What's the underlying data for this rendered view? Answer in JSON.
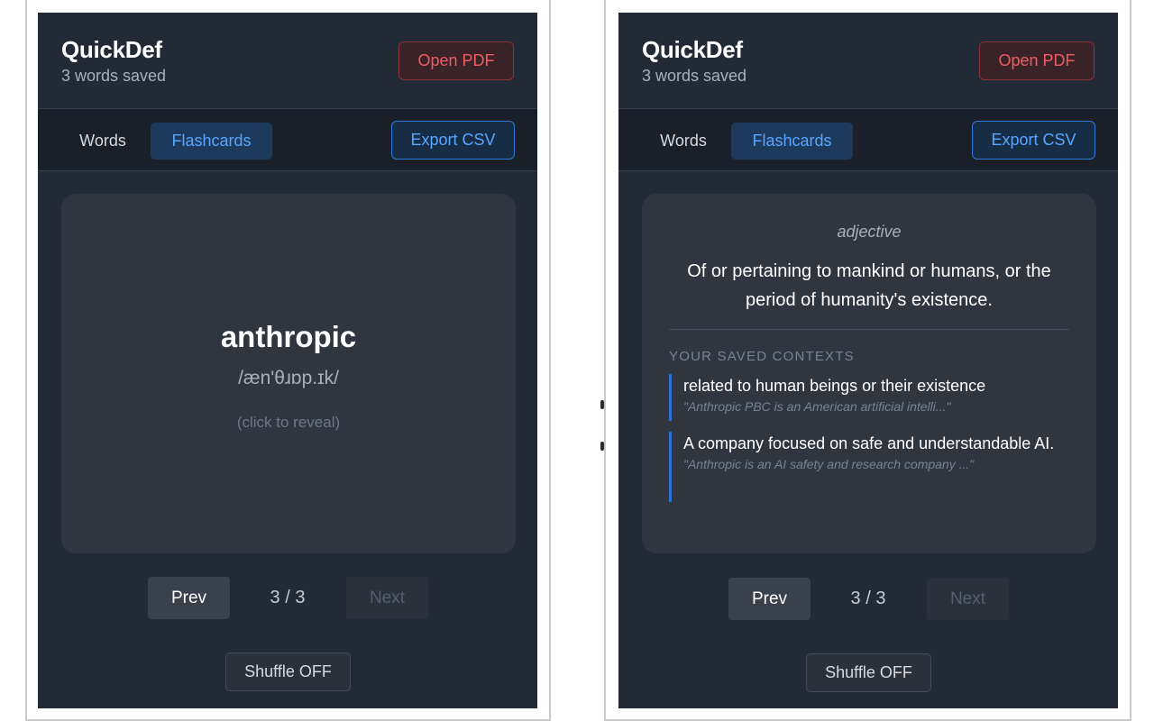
{
  "app": {
    "title": "QuickDef",
    "subtitle": "3 words saved",
    "open_pdf_label": "Open PDF"
  },
  "tabs": {
    "words_label": "Words",
    "flashcards_label": "Flashcards",
    "active": "Flashcards",
    "export_label": "Export CSV"
  },
  "card_front": {
    "word": "anthropic",
    "phonetic": "/æn'θɹɒp.ɪk/",
    "hint": "(click to reveal)"
  },
  "card_back": {
    "part_of_speech": "adjective",
    "definition": "Of or pertaining to mankind or humans, or the period of humanity's existence.",
    "contexts_heading": "YOUR SAVED CONTEXTS",
    "contexts": [
      {
        "definition": "related to human beings or their existence",
        "quote": "\"Anthropic PBC is an American artificial intelli...\""
      },
      {
        "definition": "A company focused on safe and understandable AI.",
        "quote": "\"Anthropic is an AI safety and research company ...\""
      }
    ]
  },
  "navigation": {
    "prev_label": "Prev",
    "next_label": "Next",
    "counter": "3 / 3",
    "next_disabled": true
  },
  "shuffle": {
    "label": "Shuffle OFF"
  },
  "colors": {
    "panel_bg": "#222b35",
    "accent_blue": "#58a6ff",
    "danger_red": "#ef5b61",
    "context_bar": "#2f6fd0"
  }
}
